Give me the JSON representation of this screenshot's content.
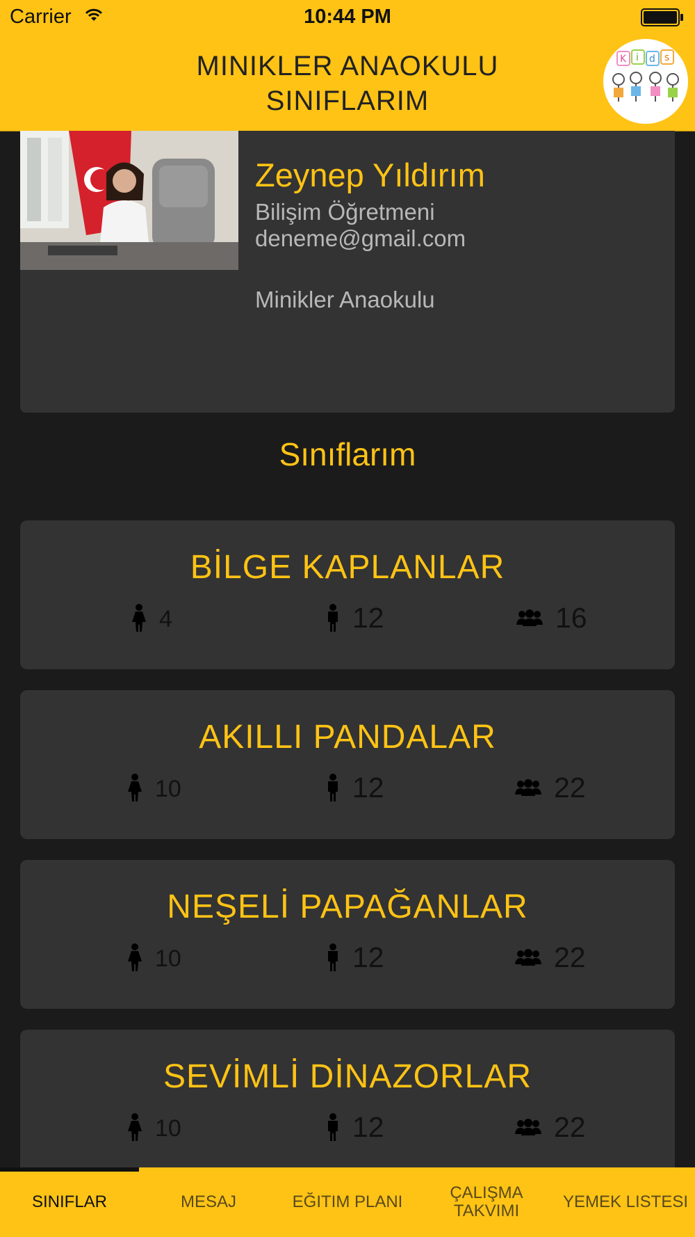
{
  "status_bar": {
    "carrier": "Carrier",
    "time": "10:44 PM"
  },
  "header": {
    "title_line1": "MINIKLER ANAOKULU",
    "title_line2": "SINIFLARIM",
    "logo_text": "Kids"
  },
  "profile": {
    "name": "Zeynep Yıldırım",
    "role": "Bilişim Öğretmeni",
    "email": "deneme@gmail.com",
    "school": "Minikler Anaokulu"
  },
  "section_title": "Sınıflarım",
  "classes": [
    {
      "name": "BİLGE KAPLANLAR",
      "girls": "4",
      "boys": "12",
      "total": "16"
    },
    {
      "name": "AKILLI PANDALAR",
      "girls": "10",
      "boys": "12",
      "total": "22"
    },
    {
      "name": "NEŞELİ PAPAĞANLAR",
      "girls": "10",
      "boys": "12",
      "total": "22"
    },
    {
      "name": "SEVİMLİ DİNAZORLAR",
      "girls": "10",
      "boys": "12",
      "total": "22"
    }
  ],
  "tabs": [
    {
      "label": "SINIFLAR"
    },
    {
      "label": "MESAJ"
    },
    {
      "label": "EĞITIM PLANI"
    },
    {
      "label": "ÇALIŞMA TAKVIMI"
    },
    {
      "label": "YEMEK LISTESI"
    }
  ],
  "colors": {
    "accent": "#fec315",
    "card": "#333333",
    "background": "#1b1b1b"
  },
  "icons": {
    "girl": "female-icon",
    "boy": "male-icon",
    "group": "group-icon"
  }
}
